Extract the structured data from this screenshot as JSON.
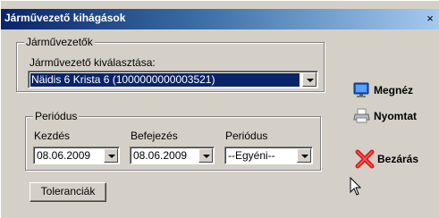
{
  "window": {
    "title": "Járművezető kihágások",
    "close_glyph": "×"
  },
  "driver_group": {
    "legend": "Járművezetők",
    "label": "Járművezető kiválasztása:",
    "selected_value": "Näidis 6 Krista 6 (1000000000003521)"
  },
  "period_group": {
    "legend": "Periódus",
    "start_label": "Kezdés",
    "start_value": "08.06.2009",
    "end_label": "Befejezés",
    "end_value": "08.06.2009",
    "period_label": "Periódus",
    "period_value": "--Egyéni--"
  },
  "buttons": {
    "tolerances": "Toleranciák",
    "view": "Megnéz",
    "print": "Nyomtat",
    "close": "Bezárás"
  },
  "icons": {
    "view": "monitor-icon",
    "print": "printer-icon",
    "close": "red-x-icon"
  },
  "colors": {
    "title_start": "#0a246a",
    "title_end": "#a6caf0",
    "selection": "#0a246a",
    "close_red": "#d42020"
  }
}
